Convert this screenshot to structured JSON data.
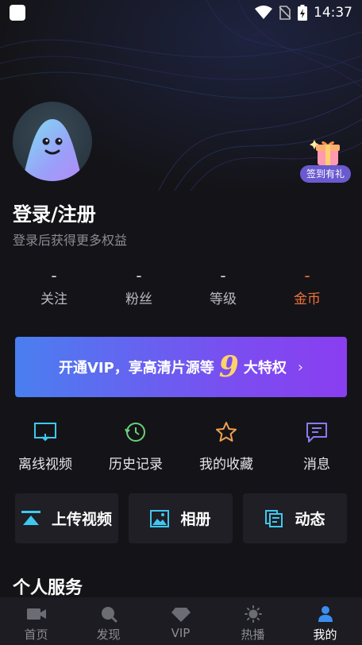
{
  "status": {
    "time": "14:37"
  },
  "profile": {
    "login_title": "登录/注册",
    "login_subtitle": "登录后获得更多权益",
    "checkin_label": "签到有礼"
  },
  "stats": [
    {
      "value": "-",
      "label": "关注"
    },
    {
      "value": "-",
      "label": "粉丝"
    },
    {
      "value": "-",
      "label": "等级"
    },
    {
      "value": "-",
      "label": "金币"
    }
  ],
  "vip_banner": {
    "prefix": "开通VIP，享高清片源等",
    "number": "9",
    "suffix": "大特权",
    "chevron": "›"
  },
  "quick_actions": [
    {
      "label": "离线视频",
      "icon": "offline-video-icon"
    },
    {
      "label": "历史记录",
      "icon": "history-icon"
    },
    {
      "label": "我的收藏",
      "icon": "star-icon"
    },
    {
      "label": "消息",
      "icon": "message-icon"
    }
  ],
  "tiles": [
    {
      "label": "上传视频",
      "icon": "upload-icon"
    },
    {
      "label": "相册",
      "icon": "album-icon"
    },
    {
      "label": "动态",
      "icon": "feed-icon"
    }
  ],
  "section": {
    "title": "个人服务"
  },
  "tabs": [
    {
      "label": "首页",
      "icon": "video-camera-icon"
    },
    {
      "label": "发现",
      "icon": "search-icon"
    },
    {
      "label": "VIP",
      "icon": "diamond-icon"
    },
    {
      "label": "热播",
      "icon": "sun-icon"
    },
    {
      "label": "我的",
      "icon": "user-icon"
    }
  ],
  "colors": {
    "coin": "#f0723a",
    "accent_cyan": "#3ec8f0",
    "tab_active": "#3a8ef0"
  }
}
